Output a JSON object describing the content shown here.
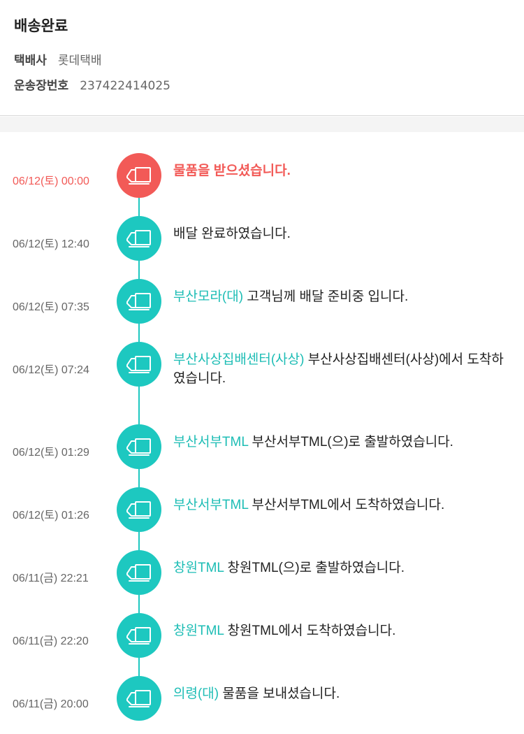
{
  "header": {
    "status_title": "배송완료",
    "carrier_label": "택배사",
    "carrier_value": "롯데택배",
    "tracking_label": "운송장번호",
    "tracking_value": "237422414025"
  },
  "colors": {
    "accent_teal": "#1dc8c0",
    "current_red": "#f25a57",
    "location_text": "#1dbdb5"
  },
  "icons": {
    "event_icon": "truck-icon"
  },
  "events": [
    {
      "time": "06/12(토) 00:00",
      "location": "",
      "message": "물품을 받으셨습니다.",
      "current": true
    },
    {
      "time": "06/12(토) 12:40",
      "location": "",
      "message": "배달 완료하였습니다.",
      "current": false
    },
    {
      "time": "06/12(토) 07:35",
      "location": "부산모라(대)",
      "message": "고객님께 배달 준비중 입니다.",
      "current": false
    },
    {
      "time": "06/12(토) 07:24",
      "location": "부산사상집배센터(사상)",
      "message": "부산사상집배센터(사상)에서 도착하였습니다.",
      "current": false
    },
    {
      "time": "06/12(토) 01:29",
      "location": "부산서부TML",
      "message": "부산서부TML(으)로 출발하였습니다.",
      "current": false
    },
    {
      "time": "06/12(토) 01:26",
      "location": "부산서부TML",
      "message": "부산서부TML에서 도착하였습니다.",
      "current": false
    },
    {
      "time": "06/11(금) 22:21",
      "location": "창원TML",
      "message": "창원TML(으)로 출발하였습니다.",
      "current": false
    },
    {
      "time": "06/11(금) 22:20",
      "location": "창원TML",
      "message": "창원TML에서 도착하였습니다.",
      "current": false
    },
    {
      "time": "06/11(금) 20:00",
      "location": "의령(대)",
      "message": "물품을 보내셨습니다.",
      "current": false
    }
  ]
}
